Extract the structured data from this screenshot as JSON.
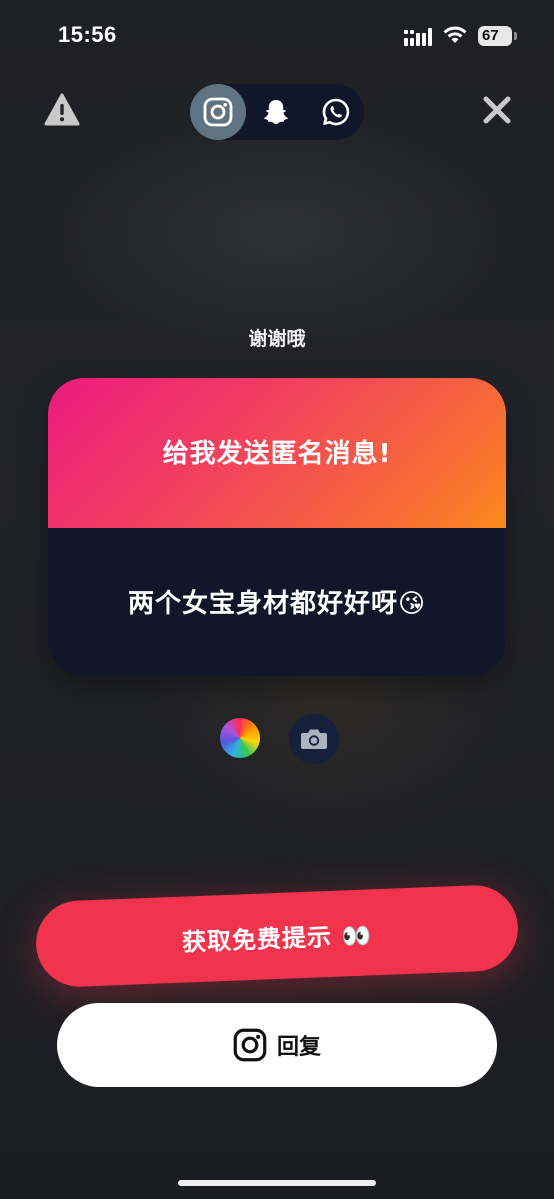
{
  "status_bar": {
    "time": "15:56",
    "battery": "67",
    "icons": [
      "signal-icon",
      "wifi-icon",
      "battery-icon"
    ]
  },
  "top_bar": {
    "left_icon": "warning-icon",
    "right_icon": "close-icon",
    "platforms": [
      {
        "name": "instagram",
        "icon": "instagram-icon",
        "active": true
      },
      {
        "name": "snapchat",
        "icon": "snapchat-ghost-icon",
        "active": false
      },
      {
        "name": "whatsapp",
        "icon": "whatsapp-icon",
        "active": false
      }
    ]
  },
  "thanks_text": "谢谢哦",
  "card": {
    "prompt": "给我发送匿名消息!",
    "message": "两个女宝身材都好好呀😘",
    "gradient_colors": [
      "#ec1a7f",
      "#fb8a1c"
    ],
    "body_color": "#111729"
  },
  "tools": {
    "color_picker_icon": "color-wheel-icon",
    "camera_icon": "camera-icon"
  },
  "buttons": {
    "hint_label": "获取免费提示 👀",
    "reply_label": "回复",
    "reply_icon": "instagram-icon",
    "hint_color": "#f2334e"
  }
}
